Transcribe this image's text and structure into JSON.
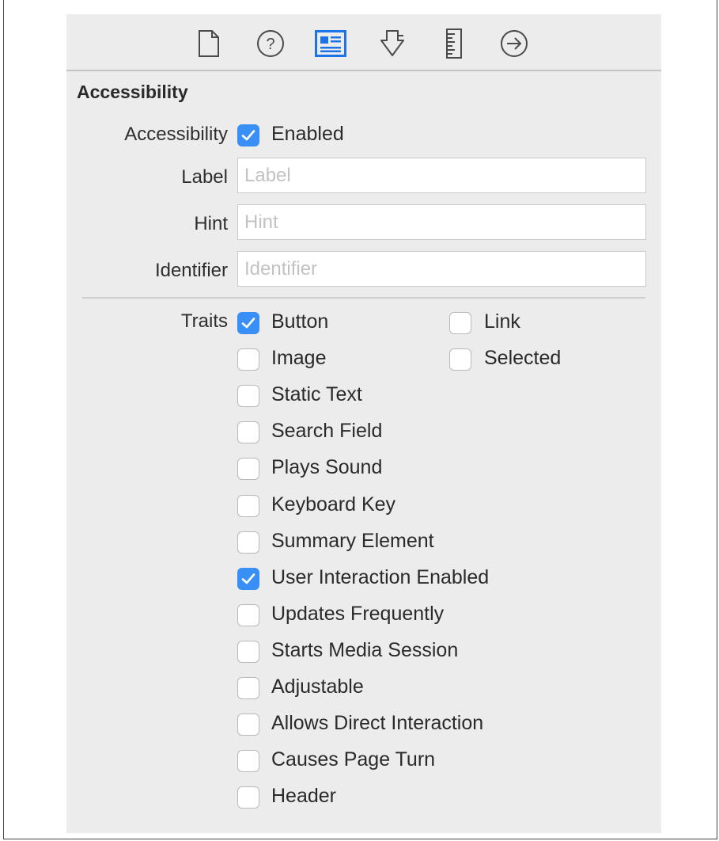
{
  "toolbar": {
    "icons": [
      "file-icon",
      "quick-help-icon",
      "identity-inspector-icon",
      "attributes-inspector-icon",
      "size-inspector-icon",
      "connections-inspector-icon"
    ],
    "active_color": "#1a73e8"
  },
  "section": {
    "title": "Accessibility"
  },
  "accessibility": {
    "label": "Accessibility",
    "enabled_label": "Enabled",
    "enabled_checked": true
  },
  "fields": {
    "label": {
      "label": "Label",
      "placeholder": "Label",
      "value": ""
    },
    "hint": {
      "label": "Hint",
      "placeholder": "Hint",
      "value": ""
    },
    "identifier": {
      "label": "Identifier",
      "placeholder": "Identifier",
      "value": ""
    }
  },
  "traits": {
    "label": "Traits",
    "left": [
      {
        "label": "Button",
        "checked": true
      },
      {
        "label": "Image",
        "checked": false
      },
      {
        "label": "Static Text",
        "checked": false
      },
      {
        "label": "Search Field",
        "checked": false
      },
      {
        "label": "Plays Sound",
        "checked": false
      },
      {
        "label": "Keyboard Key",
        "checked": false
      },
      {
        "label": "Summary Element",
        "checked": false
      },
      {
        "label": "User Interaction Enabled",
        "checked": true
      },
      {
        "label": "Updates Frequently",
        "checked": false
      },
      {
        "label": "Starts Media Session",
        "checked": false
      },
      {
        "label": "Adjustable",
        "checked": false
      },
      {
        "label": "Allows Direct Interaction",
        "checked": false
      },
      {
        "label": "Causes Page Turn",
        "checked": false
      },
      {
        "label": "Header",
        "checked": false
      }
    ],
    "right": [
      {
        "label": "Link",
        "checked": false
      },
      {
        "label": "Selected",
        "checked": false
      }
    ]
  },
  "colors": {
    "checkbox_checked": "#3a8ff7",
    "panel_background": "#ececec"
  }
}
